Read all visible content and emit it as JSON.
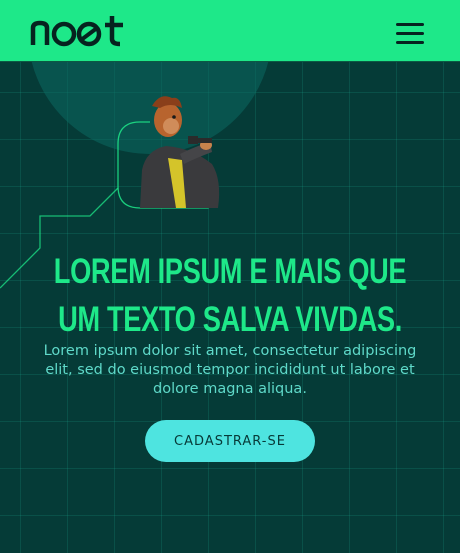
{
  "header": {
    "logo_text": "noet",
    "menu_icon": "hamburger-menu-icon",
    "background": "#1ee889"
  },
  "hero": {
    "character_image": "monkey-with-gun-illustration",
    "headline_line1": "LOREM IPSUM E MAIS QUE",
    "headline_line2": "UM TEXTO SALVA VIVDAS.",
    "description": "Lorem ipsum dolor sit amet, consectetur adipiscing elit, sed do eiusmod tempor incididunt ut labore et dolore magna aliqua.",
    "cta_label": "CADASTRAR-SE"
  },
  "colors": {
    "background": "#053b37",
    "accent_green": "#1ee889",
    "text_teal": "#5fd9c9",
    "button_cyan": "#4ee4e0"
  }
}
